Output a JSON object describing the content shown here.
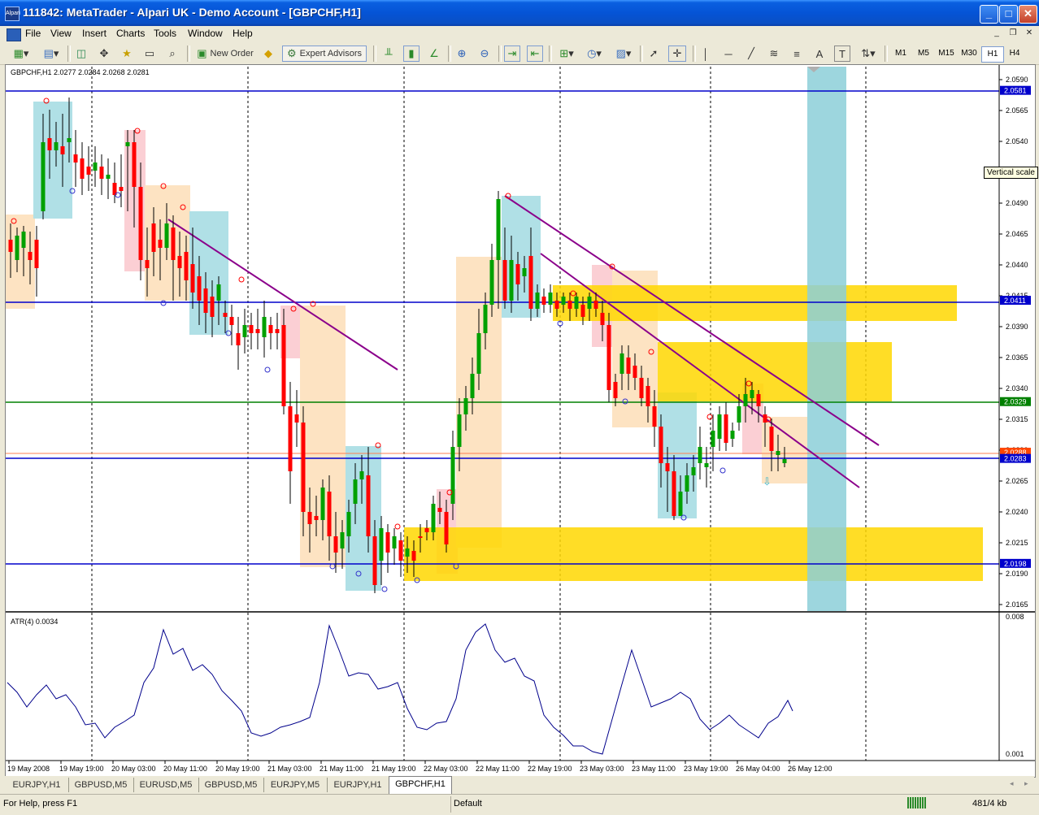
{
  "window": {
    "title": "111842: MetaTrader - Alpari UK - Demo Account - [GBPCHF,H1]",
    "icon_text": "Alpari"
  },
  "menu": [
    "File",
    "View",
    "Insert",
    "Charts",
    "Tools",
    "Window",
    "Help"
  ],
  "toolbar": {
    "new_order": "New Order",
    "expert_advisors": "Expert Advisors",
    "drawing_tools": [
      "A",
      "T"
    ],
    "timeframes": [
      "M1",
      "M5",
      "M15",
      "M30",
      "H1",
      "H4"
    ],
    "active_timeframe": "H1"
  },
  "chart": {
    "header": "GBPCHF,H1  2.0277 2.0284 2.0268 2.0281",
    "indicator_label": "ATR(4) 0.0034",
    "tooltip": "Vertical scale",
    "price_ticks": [
      "2.0590",
      "2.0565",
      "2.0540",
      "2.0515",
      "2.0490",
      "2.0465",
      "2.0440",
      "2.0415",
      "2.0390",
      "2.0365",
      "2.0340",
      "2.0315",
      "2.0290",
      "2.0265",
      "2.0240",
      "2.0215",
      "2.0190",
      "2.0165"
    ],
    "price_markers": [
      {
        "value": "2.0581",
        "color": "#0000cc"
      },
      {
        "value": "2.0411",
        "color": "#0000cc"
      },
      {
        "value": "2.0329",
        "color": "#008000"
      },
      {
        "value": "2.0288",
        "color": "#ff4500"
      },
      {
        "value": "2.0283",
        "color": "#0000cc"
      },
      {
        "value": "2.0198",
        "color": "#0000cc"
      }
    ],
    "atr_ticks": [
      "0.008",
      "0.001"
    ],
    "time_labels": [
      "19 May 2008",
      "19 May 19:00",
      "20 May 03:00",
      "20 May 11:00",
      "20 May 19:00",
      "21 May 03:00",
      "21 May 11:00",
      "21 May 19:00",
      "22 May 03:00",
      "22 May 11:00",
      "22 May 19:00",
      "23 May 03:00",
      "23 May 11:00",
      "23 May 19:00",
      "26 May 04:00",
      "26 May 12:00"
    ]
  },
  "tabs": [
    "EURJPY,H1",
    "GBPUSD,M5",
    "EURUSD,M5",
    "GBPUSD,M5",
    "EURJPY,M5",
    "EURJPY,H1",
    "GBPCHF,H1"
  ],
  "active_tab": "GBPCHF,H1",
  "status": {
    "help": "For Help, press F1",
    "profile": "Default",
    "traffic": "481/4 kb"
  }
}
